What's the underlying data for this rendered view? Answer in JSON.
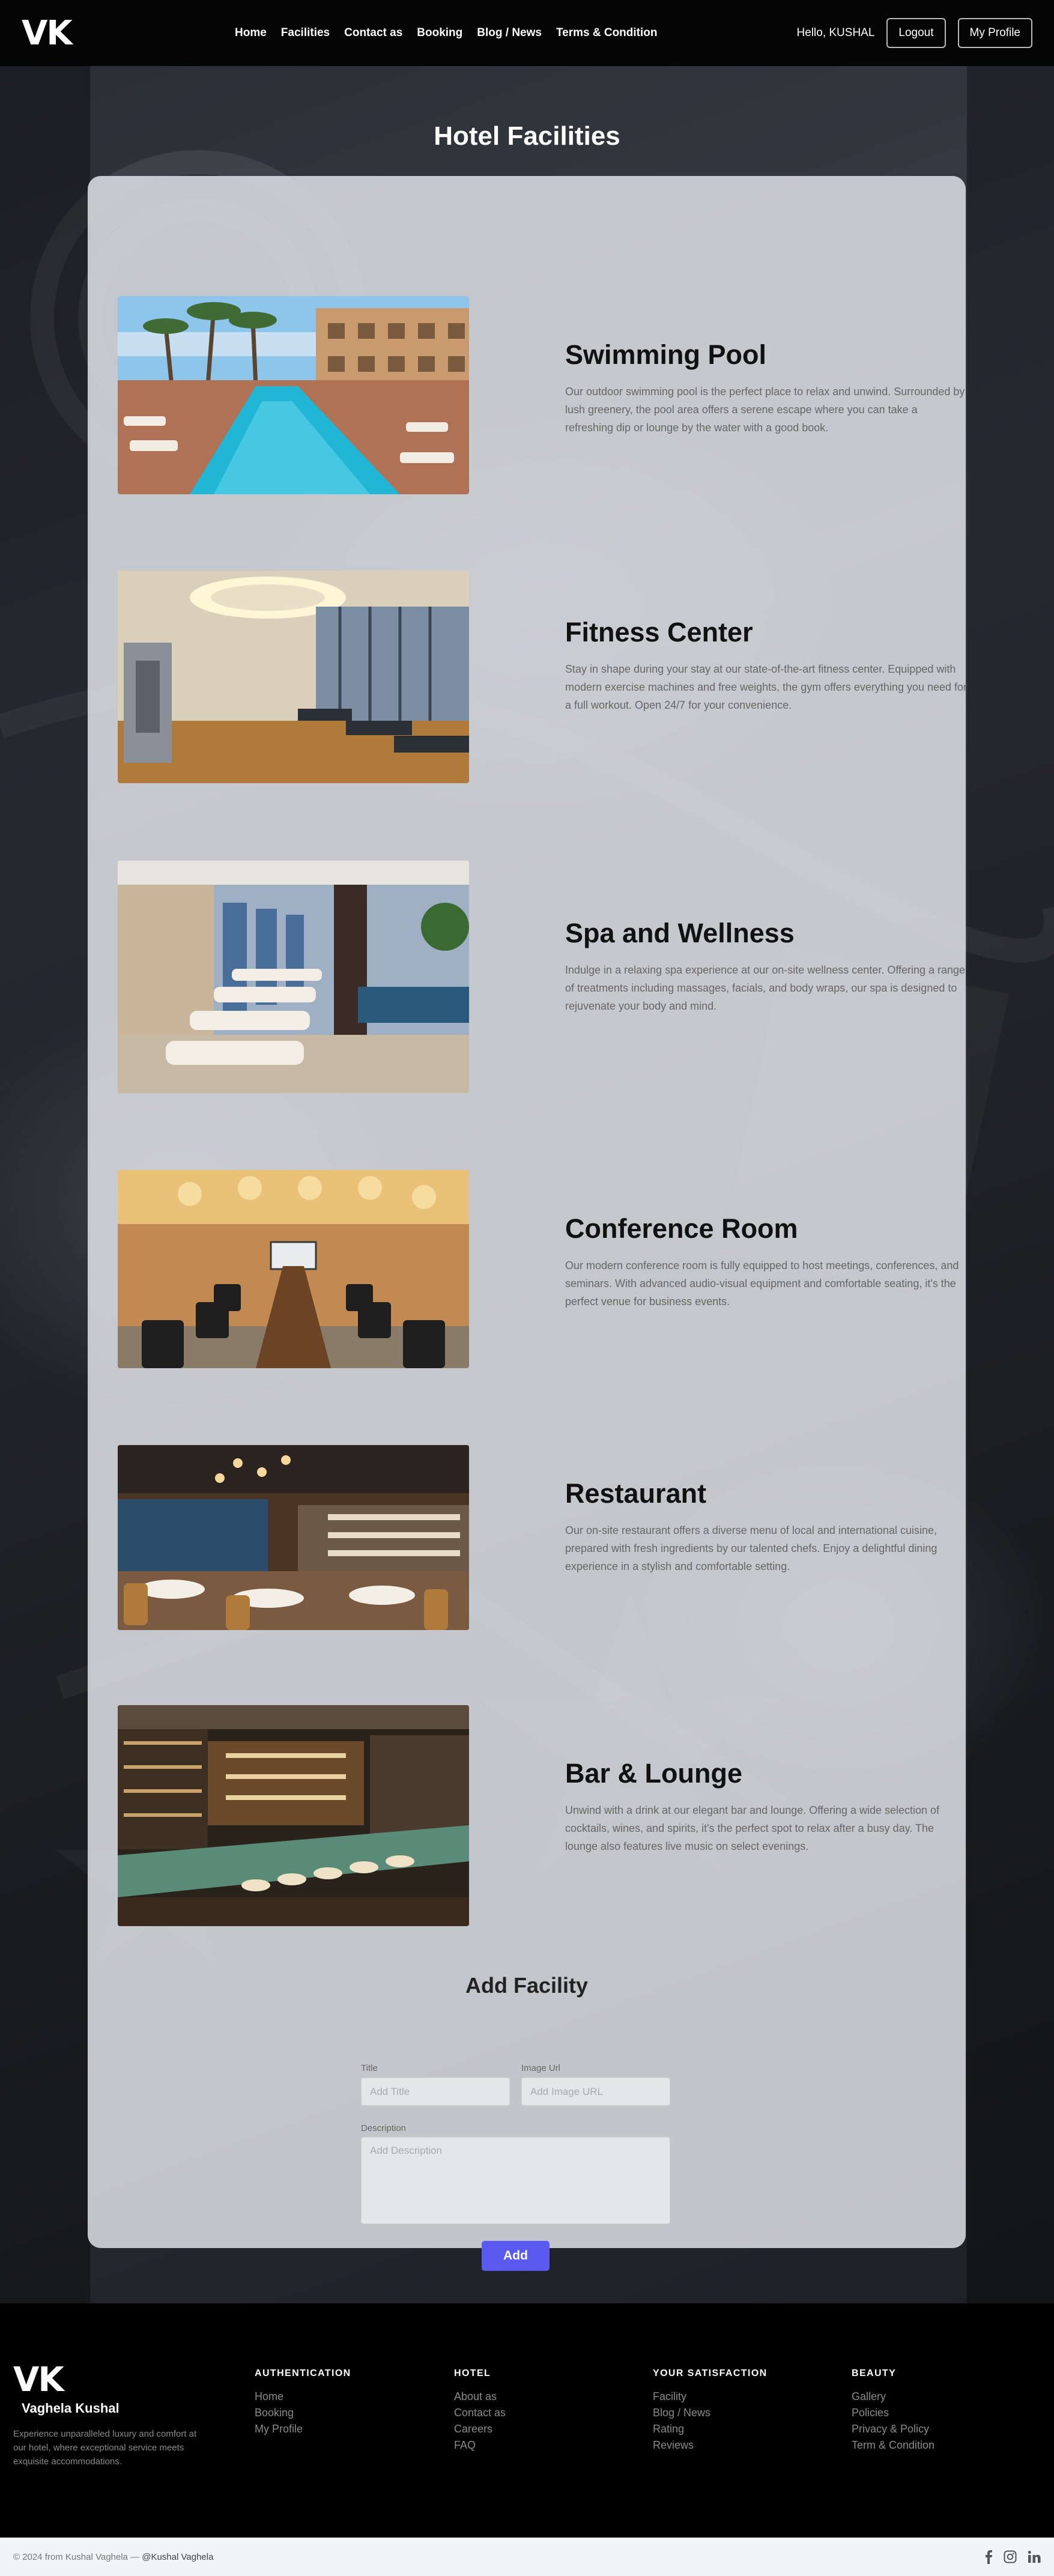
{
  "navbar": {
    "brand": "VK",
    "links": [
      "Home",
      "Facilities",
      "Contact as",
      "Booking",
      "Blog / News",
      "Terms & Condition"
    ],
    "greeting": "Hello, KUSHAL",
    "logout": "Logout",
    "profile": "My Profile"
  },
  "page": {
    "title": "Hotel Facilities"
  },
  "facilities": [
    {
      "name": "Swimming Pool",
      "description": "Our outdoor swimming pool is the perfect place to relax and unwind. Surrounded by lush greenery, the pool area offers a serene escape where you can take a refreshing dip or lounge by the water with a good book."
    },
    {
      "name": "Fitness Center",
      "description": "Stay in shape during your stay at our state-of-the-art fitness center. Equipped with modern exercise machines and free weights, the gym offers everything you need for a full workout. Open 24/7 for your convenience."
    },
    {
      "name": "Spa and Wellness",
      "description": "Indulge in a relaxing spa experience at our on-site wellness center. Offering a range of treatments including massages, facials, and body wraps, our spa is designed to rejuvenate your body and mind."
    },
    {
      "name": "Conference Room",
      "description": "Our modern conference room is fully equipped to host meetings, conferences, and seminars. With advanced audio-visual equipment and comfortable seating, it's the perfect venue for business events."
    },
    {
      "name": "Restaurant",
      "description": "Our on-site restaurant offers a diverse menu of local and international cuisine, prepared with fresh ingredients by our talented chefs. Enjoy a delightful dining experience in a stylish and comfortable setting."
    },
    {
      "name": "Bar & Lounge",
      "description": "Unwind with a drink at our elegant bar and lounge. Offering a wide selection of cocktails, wines, and spirits, it's the perfect spot to relax after a busy day. The lounge also features live music on select evenings."
    }
  ],
  "form": {
    "title": "Add Facility",
    "title_label": "Title",
    "title_placeholder": "Add Title",
    "image_label": "Image Url",
    "image_placeholder": "Add Image URL",
    "description_label": "Description",
    "description_placeholder": "Add Description",
    "submit": "Add"
  },
  "footer": {
    "logo": "VK",
    "owner": "Vaghela Kushal",
    "tagline": "Experience unparalleled luxury and comfort at our hotel, where exceptional service meets exquisite accommodations.",
    "columns": [
      {
        "heading": "AUTHENTICATION",
        "links": [
          "Home",
          "Booking",
          "My Profile"
        ]
      },
      {
        "heading": "HOTEL",
        "links": [
          "About as",
          "Contact as",
          "Careers",
          "FAQ"
        ]
      },
      {
        "heading": "YOUR SATISFACTION",
        "links": [
          "Facility",
          "Blog / News",
          "Rating",
          "Reviews"
        ]
      },
      {
        "heading": "BEAUTY",
        "links": [
          "Gallery",
          "Policies",
          "Privacy & Policy",
          "Term & Condition"
        ]
      }
    ],
    "copyright_prefix": "© 2024 from Kushal Vaghela —",
    "copyright_handle": "@Kushal Vaghela",
    "social_icons": [
      "facebook-icon",
      "instagram-icon",
      "linkedin-icon"
    ]
  }
}
